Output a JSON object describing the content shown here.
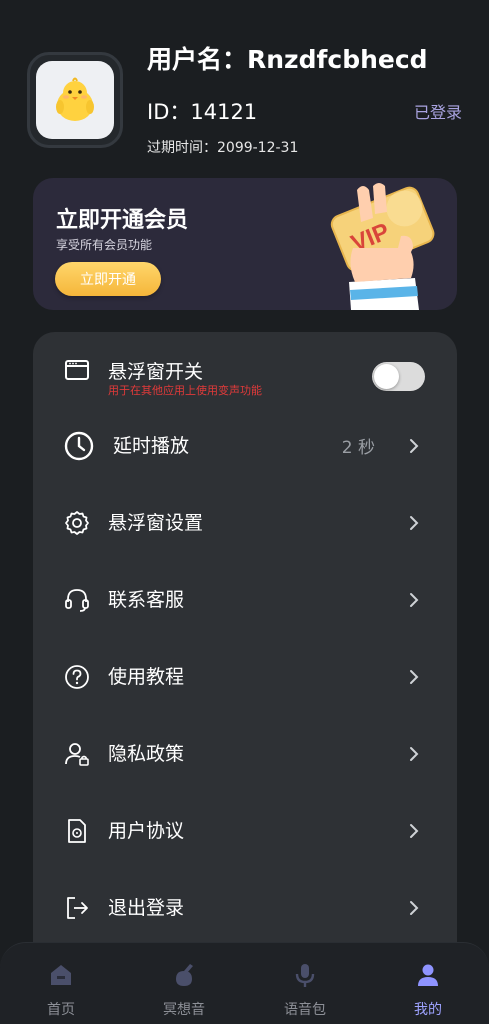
{
  "profile": {
    "username": "用户名：Rnzdfcbhecd",
    "id": "ID：14121",
    "expire": "过期时间：2099-12-31",
    "login_status": "已登录"
  },
  "vip": {
    "title": "立即开通会员",
    "subtitle": "享受所有会员功能",
    "button": "立即开通",
    "card_text": "VIP"
  },
  "menu": {
    "float_window": {
      "label": "悬浮窗开关",
      "hint": "用于在其他应用上使用变声功能",
      "enabled": false
    },
    "delay": {
      "label": "延时播放",
      "value": "2 秒"
    },
    "float_settings": {
      "label": "悬浮窗设置"
    },
    "support": {
      "label": "联系客服"
    },
    "tutorial": {
      "label": "使用教程"
    },
    "privacy": {
      "label": "隐私政策"
    },
    "agreement": {
      "label": "用户协议"
    },
    "logout": {
      "label": "退出登录"
    }
  },
  "nav": {
    "items": [
      {
        "label": "首页",
        "icon": "home-icon"
      },
      {
        "label": "冥想音",
        "icon": "meditation-icon"
      },
      {
        "label": "语音包",
        "icon": "microphone-icon"
      },
      {
        "label": "我的",
        "icon": "profile-icon"
      }
    ],
    "active_index": 3
  },
  "colors": {
    "background": "#1b1e21",
    "card": "#2e3135",
    "accent": "#9ea3ff",
    "vip_gold": "#f5b63a",
    "hint_red": "#e03a3a"
  }
}
